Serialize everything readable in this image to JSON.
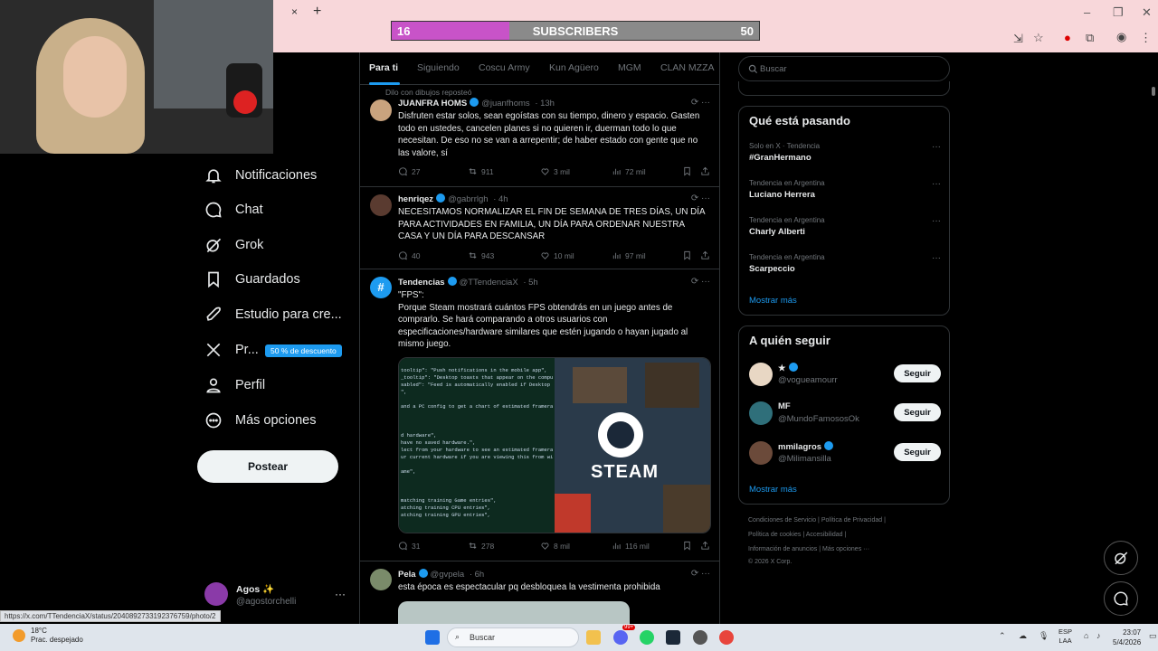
{
  "overlay": {
    "left_count": "16",
    "label": "SUBSCRIBERS",
    "right_count": "50",
    "progress": 0.32
  },
  "browser": {
    "tab_close": "×",
    "new_tab": "+"
  },
  "nav": [
    {
      "label": "Notificaciones",
      "icon": "bell-icon"
    },
    {
      "label": "Chat",
      "icon": "chat-icon"
    },
    {
      "label": "Grok",
      "icon": "grok-icon"
    },
    {
      "label": "Guardados",
      "icon": "bookmark-icon"
    },
    {
      "label": "Estudio para cre...",
      "icon": "rocket-icon"
    },
    {
      "label": "Pr...",
      "icon": "x-logo-icon"
    },
    {
      "label": "Perfil",
      "icon": "person-icon"
    },
    {
      "label": "Más opciones",
      "icon": "more-circle-icon"
    }
  ],
  "promo_badge": "50 % de descuento",
  "post_button": "Postear",
  "account": {
    "name": "Agos ✨",
    "handle": "@agostorchelli",
    "more": "···"
  },
  "status_url": "https://x.com/TTendenciaX/status/2040892733192376759/photo/2",
  "tabs": [
    "Para ti",
    "Siguiendo",
    "Coscu Army",
    "Kun Agüero",
    "MGM",
    "CLAN MZZA"
  ],
  "repost_line": "Dilo con dibujos reposteó",
  "tweets": [
    {
      "name": "JUANFRA HOMS",
      "handle": "@juanfhoms",
      "time": "· 13h",
      "text": "Disfruten estar solos, sean egoístas con su tiempo, dinero y espacio. Gasten todo en ustedes, cancelen planes si no quieren ir, duerman todo lo que necesitan. De eso no se van a arrepentir; de haber estado con gente que no las valore, sí",
      "replies": "27",
      "reposts": "911",
      "likes": "3 mil",
      "views": "72 mil"
    },
    {
      "name": "henriqez",
      "handle": "@gabrrlgh",
      "time": "· 4h",
      "text": "NECESITAMOS NORMALIZAR EL FIN DE SEMANA DE TRES DÍAS, UN DÍA PARA ACTIVIDADES EN FAMILIA, UN DÍA PARA ORDENAR NUESTRA CASA Y UN DÍA PARA DESCANSAR",
      "replies": "40",
      "reposts": "943",
      "likes": "10 mil",
      "views": "97 mil"
    },
    {
      "name": "Tendencias",
      "handle": "@TTendenciaX",
      "time": "· 5h",
      "text": "\"FPS\":\nPorque Steam mostrará cuántos FPS obtendrás en un juego antes de comprarlo. Se hará comparando a otros usuarios con especificaciones/hardware similares que estén jugando o hayan jugado al mismo juego.",
      "replies": "31",
      "reposts": "278",
      "likes": "8 mil",
      "views": "116 mil"
    },
    {
      "name": "Pela",
      "handle": "@gvpela",
      "time": "· 6h",
      "text": "esta época es espectacular pq desbloquea la vestimenta prohibida"
    }
  ],
  "media_code_lines": [
    "tooltip\": \"Push notifications in the mobile app\",",
    "_tooltip\": \"Desktop toasts that appear on the computer the desk",
    "sabled\": \"Feed is automatically enabled if Desktop app or Mobil",
    "\",",
    "",
    "and a PC config to get a chart of estimated framerates, based o",
    "",
    "",
    "",
    "d hardware\",",
    "have no saved hardware.\",",
    "lect from your hardware to see an estimated framerate.\",",
    "ur current hardware if you are viewing this from within the St",
    "",
    "ame\",",
    "",
    "",
    "",
    "matching training Game entries\",",
    "atching training CPU entries\",",
    "atching training GPU entries\","
  ],
  "steam_word": "STEAM",
  "search_placeholder": "Buscar",
  "trending": {
    "title": "Qué está pasando",
    "items": [
      {
        "category": "Solo en X · Tendencia",
        "name": "#GranHermano"
      },
      {
        "category": "Tendencia en Argentina",
        "name": "Luciano Herrera"
      },
      {
        "category": "Tendencia en Argentina",
        "name": "Charly Alberti"
      },
      {
        "category": "Tendencia en Argentina",
        "name": "Scarpeccio"
      }
    ],
    "show_more": "Mostrar más"
  },
  "who_to_follow": {
    "title": "A quién seguir",
    "items": [
      {
        "name": "★",
        "handle": "@vogueamourr",
        "button": "Seguir"
      },
      {
        "name": "MF",
        "handle": "@MundoFamososOk",
        "button": "Seguir"
      },
      {
        "name": "mmilagros",
        "handle": "@Milimansilla",
        "button": "Seguir"
      }
    ],
    "show_more": "Mostrar más"
  },
  "footer": {
    "line1": [
      "Condiciones de Servicio",
      "Política de Privacidad"
    ],
    "line2": [
      "Política de cookies",
      "Accesibilidad"
    ],
    "line3": [
      "Información de anuncios",
      "Más opciones ···"
    ],
    "line4": "© 2026 X Corp."
  },
  "taskbar": {
    "temp": "18°C",
    "weather": "Prac. despejado",
    "search": "Buscar",
    "lang_top": "ESP",
    "lang_bottom": "LAA",
    "time": "23:07",
    "date": "5/4/2026",
    "badge": "99+"
  },
  "colors": {
    "accent": "#1d9bf0",
    "overlay_fill": "#c853c8",
    "browser_pink": "#f8d7da"
  }
}
